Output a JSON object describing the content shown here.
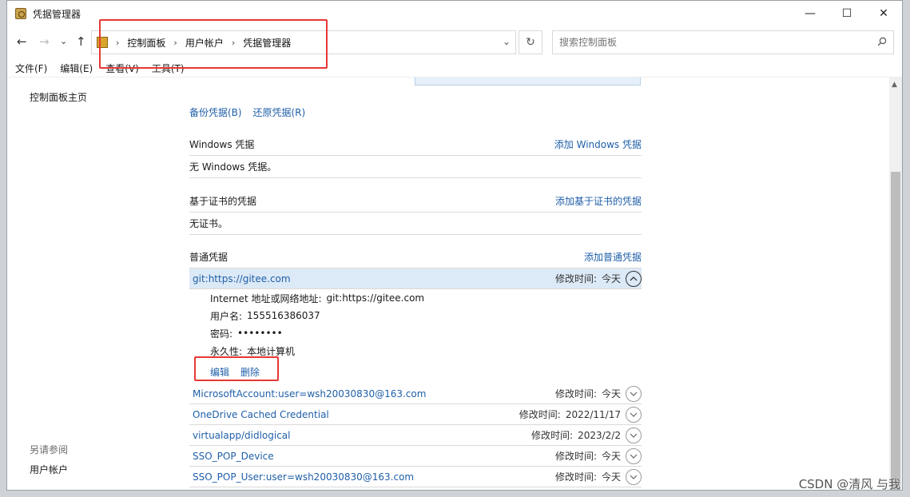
{
  "window": {
    "title": "凭据管理器",
    "controls": {
      "minimize": "—",
      "maximize": "☐",
      "close": "✕"
    }
  },
  "nav": {
    "back": "←",
    "forward": "→",
    "recent": "⌄",
    "up": "↑"
  },
  "breadcrumb": {
    "items": [
      "控制面板",
      "用户帐户",
      "凭据管理器"
    ],
    "sep": "›",
    "dropdown": "⌄",
    "refresh": "↻"
  },
  "search": {
    "placeholder": "搜索控制面板"
  },
  "menu": {
    "items": [
      "文件(F)",
      "编辑(E)",
      "查看(V)",
      "工具(T)"
    ]
  },
  "left_nav": {
    "home": "控制面板主页",
    "see_also": "另请参阅",
    "user_accounts": "用户帐户"
  },
  "backup": {
    "backup_label": "备份凭据(B)",
    "restore_label": "还原凭据(R)"
  },
  "windows_creds": {
    "title": "Windows 凭据",
    "add_label": "添加 Windows 凭据",
    "empty": "无 Windows 凭据。"
  },
  "cert_creds": {
    "title": "基于证书的凭据",
    "add_label": "添加基于证书的凭据",
    "empty": "无证书。"
  },
  "generic_creds": {
    "title": "普通凭据",
    "add_label": "添加普通凭据",
    "expanded": {
      "name": "git:https://gitee.com",
      "modified_label": "修改时间:",
      "modified": "今天",
      "address_label": "Internet 地址或网络地址:",
      "address": "git:https://gitee.com",
      "username_label": "用户名:",
      "username": "155516386037",
      "password_label": "密码:",
      "password": "••••••••",
      "persistence_label": "永久性:",
      "persistence": "本地计算机",
      "edit_label": "编辑",
      "delete_label": "删除"
    },
    "items": [
      {
        "name": "MicrosoftAccount:user=wsh20030830@163.com",
        "modified_label": "修改时间:",
        "modified": "今天"
      },
      {
        "name": "OneDrive Cached Credential",
        "modified_label": "修改时间:",
        "modified": "2022/11/17"
      },
      {
        "name": "virtualapp/didlogical",
        "modified_label": "修改时间:",
        "modified": "2023/2/2"
      },
      {
        "name": "SSO_POP_Device",
        "modified_label": "修改时间:",
        "modified": "今天"
      },
      {
        "name": "SSO_POP_User:user=wsh20030830@163.com",
        "modified_label": "修改时间:",
        "modified": "今天"
      }
    ]
  },
  "watermark": "CSDN @清风 与我",
  "colors": {
    "link": "#1f5fa8",
    "selected": "#dce9f6",
    "highlight": "#e53935"
  }
}
